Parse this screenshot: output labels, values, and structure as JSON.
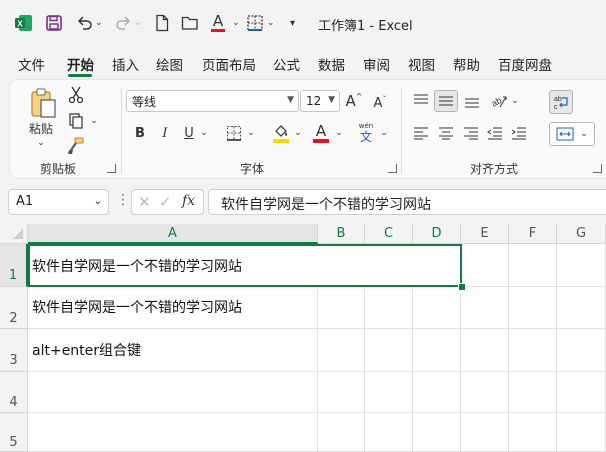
{
  "titlebar": {
    "title": "工作簿1 - Excel"
  },
  "menu": {
    "tabs": [
      "文件",
      "开始",
      "插入",
      "绘图",
      "页面布局",
      "公式",
      "数据",
      "审阅",
      "视图",
      "帮助",
      "百度网盘"
    ]
  },
  "ribbon": {
    "clipboard": {
      "label": "剪贴板",
      "paste": "粘贴"
    },
    "font": {
      "label": "字体",
      "name": "等线",
      "size": "12",
      "bold": "B",
      "italic": "I",
      "underline": "U",
      "wen": "wén",
      "wen_char": "文",
      "font_color_letter": "A",
      "grow": "A",
      "shrink": "A"
    },
    "alignment": {
      "label": "对齐方式"
    },
    "colors": {
      "accent": "#107c41",
      "red": "#e81123",
      "yellow": "#ffd700"
    }
  },
  "formula_bar": {
    "cell_ref": "A1",
    "fx": "fx",
    "content": "软件自学网是一个不错的学习网站"
  },
  "sheet": {
    "columns": [
      "A",
      "B",
      "C",
      "D",
      "E",
      "F",
      "G"
    ],
    "rows": [
      "1",
      "2",
      "3",
      "4",
      "5"
    ],
    "cells": {
      "A1": "软件自学网是一个不错的学习网站",
      "A2": "软件自学网是一个不错的学习网站",
      "A3": "alt+enter组合键"
    }
  }
}
